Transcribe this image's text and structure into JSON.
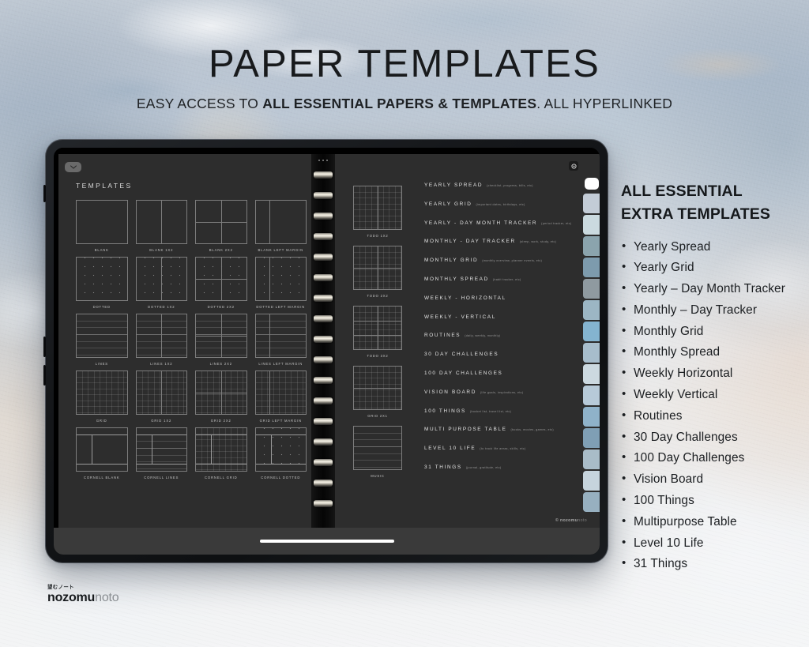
{
  "heading": {
    "title": "PAPER TEMPLATES",
    "subtitle_pre": "EASY ACCESS TO ",
    "subtitle_bold": "ALL ESSENTIAL PAPERS & TEMPLATES",
    "subtitle_post": ". ALL HYPERLINKED"
  },
  "device": {
    "collapse_icon": "chevron-down-icon",
    "toolbar_icon": "record-circle-icon",
    "watermark_pre": "© nozomu",
    "watermark_post": "noto",
    "home_indicator": "home-indicator"
  },
  "left_page": {
    "heading": "TEMPLATES",
    "templates": [
      {
        "label": "BLANK",
        "style": "blank"
      },
      {
        "label": "BLANK 1X2",
        "style": "blank-1x2"
      },
      {
        "label": "BLANK 2X2",
        "style": "blank-2x2"
      },
      {
        "label": "BLANK LEFT MARGIN",
        "style": "blank-margin"
      },
      {
        "label": "DOTTED",
        "style": "dotted"
      },
      {
        "label": "DOTTED 1X2",
        "style": "dotted-1x2"
      },
      {
        "label": "DOTTED 2X2",
        "style": "dotted-2x2"
      },
      {
        "label": "DOTTED LEFT MARGIN",
        "style": "dotted-margin"
      },
      {
        "label": "LINES",
        "style": "lines"
      },
      {
        "label": "LINES 1X2",
        "style": "lines-1x2"
      },
      {
        "label": "LINES 2X2",
        "style": "lines-2x2"
      },
      {
        "label": "LINES LEFT MARGIN",
        "style": "lines-margin"
      },
      {
        "label": "GRID",
        "style": "grid"
      },
      {
        "label": "GRID 1X2",
        "style": "grid-1x2"
      },
      {
        "label": "GRID 2X2",
        "style": "grid-2x2"
      },
      {
        "label": "GRID LEFT MARGIN",
        "style": "grid-margin"
      },
      {
        "label": "CORNELL BLANK",
        "style": "cornell-blank"
      },
      {
        "label": "CORNELL LINES",
        "style": "cornell-lines"
      },
      {
        "label": "CORNELL GRID",
        "style": "cornell-grid"
      },
      {
        "label": "CORNELL DOTTED",
        "style": "cornell-dotted"
      }
    ]
  },
  "right_page": {
    "mid_templates": [
      {
        "label": "TODO 1X2",
        "style": "todo-1x2"
      },
      {
        "label": "TODO 2X2",
        "style": "todo-2x2"
      },
      {
        "label": "TODO 3X2",
        "style": "todo-3x2"
      },
      {
        "label": "GRID 2X1",
        "style": "grid-2x1"
      },
      {
        "label": "MUSIC",
        "style": "music"
      }
    ],
    "list": [
      {
        "name": "YEARLY SPREAD",
        "desc": "(checklist, progress, bills, etc)"
      },
      {
        "name": "YEARLY GRID",
        "desc": "(important dates, birthdays, etc)"
      },
      {
        "name": "YEARLY - DAY MONTH TRACKER",
        "desc": "(period tracker, etc)"
      },
      {
        "name": "MONTHLY - DAY TRACKER",
        "desc": "(sleep, work, study, etc)"
      },
      {
        "name": "MONTHLY GRID",
        "desc": "(monthly overview, planner events, etc)"
      },
      {
        "name": "MONTHLY SPREAD",
        "desc": "(habit tracker, etc)"
      },
      {
        "name": "WEEKLY - HORIZONTAL",
        "desc": ""
      },
      {
        "name": "WEEKLY - VERTICAL",
        "desc": ""
      },
      {
        "name": "ROUTINES",
        "desc": "(daily, weekly, monthly)"
      },
      {
        "name": "30 DAY CHALLENGES",
        "desc": ""
      },
      {
        "name": "100 DAY CHALLENGES",
        "desc": ""
      },
      {
        "name": "VISION BOARD",
        "desc": "(life goals, inspirations, etc)"
      },
      {
        "name": "100 THINGS",
        "desc": "(bucket list, travel list, etc)"
      },
      {
        "name": "MULTI PURPOSE TABLE",
        "desc": "(books, movies, games, etc)"
      },
      {
        "name": "LEVEL 10 LIFE",
        "desc": "(to track life areas, skills, etc)"
      },
      {
        "name": "31 THINGS",
        "desc": "(journal, gratitude, etc)"
      }
    ],
    "tabs": [
      "#ffffff",
      "#c3ccd6",
      "#cbdadf",
      "#8ba4ad",
      "#7d9bad",
      "#8f9aa0",
      "#9cb6c4",
      "#84b4d0",
      "#a7bdcc",
      "#ccd9e0",
      "#b7cad8",
      "#8fb2c9",
      "#7f9fb5",
      "#a9bcc8",
      "#c6d4dd",
      "#97b0c0"
    ]
  },
  "panel": {
    "title_line1": "ALL ESSENTIAL",
    "title_line2": "EXTRA TEMPLATES",
    "items": [
      "Yearly Spread",
      "Yearly Grid",
      "Yearly – Day Month Tracker",
      "Monthly – Day Tracker",
      "Monthly Grid",
      "Monthly Spread",
      "Weekly Horizontal",
      "Weekly Vertical",
      "Routines",
      "30 Day Challenges",
      "100 Day Challenges",
      "Vision Board",
      "100 Things",
      "Multipurpose Table",
      "Level 10 Life",
      "31 Things"
    ]
  },
  "brand": {
    "jp": "望むノート",
    "name_bold": "nozomu",
    "name_light": "noto"
  }
}
